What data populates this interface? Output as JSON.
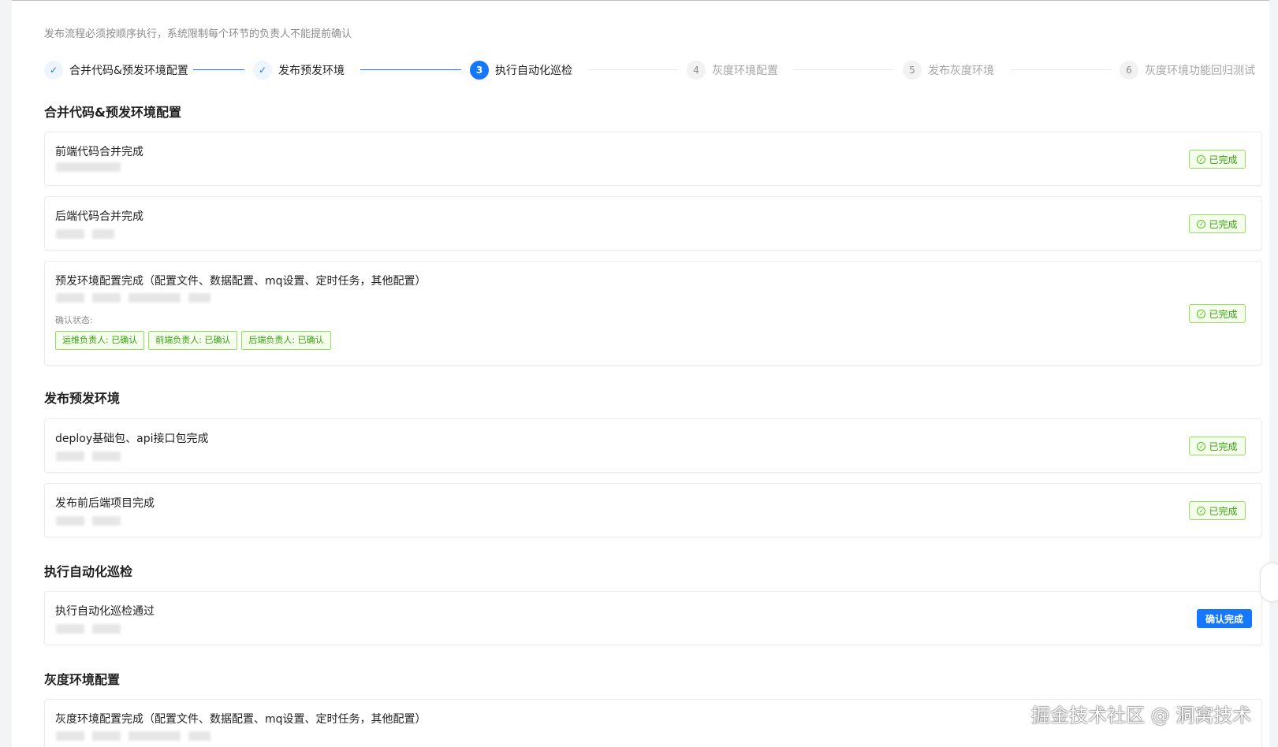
{
  "hint": "发布流程必须按顺序执行，系统限制每个环节的负责人不能提前确认",
  "steps": [
    {
      "index": "1",
      "title": "合并代码&预发环境配置",
      "status": "done",
      "icon": "check-icon"
    },
    {
      "index": "2",
      "title": "发布预发环境",
      "status": "done",
      "icon": "check-icon"
    },
    {
      "index": "3",
      "title": "执行自动化巡检",
      "status": "active"
    },
    {
      "index": "4",
      "title": "灰度环境配置",
      "status": "wait"
    },
    {
      "index": "5",
      "title": "发布灰度环境",
      "status": "wait"
    },
    {
      "index": "6",
      "title": "灰度环境功能回归测试",
      "status": "wait"
    }
  ],
  "sections": [
    {
      "title": "合并代码&预发环境配置",
      "items": [
        {
          "title": "前端代码合并完成",
          "status_label": "已完成"
        },
        {
          "title": "后端代码合并完成",
          "status_label": "已完成"
        },
        {
          "title": "预发环境配置完成（配置文件、数据配置、mq设置、定时任务，其他配置）",
          "status_label": "已完成",
          "confirm_label": "确认状态:",
          "confirm_tags": [
            "运维负责人: 已确认",
            "前端负责人: 已确认",
            "后端负责人: 已确认"
          ]
        }
      ]
    },
    {
      "title": "发布预发环境",
      "items": [
        {
          "title": "deploy基础包、api接口包完成",
          "status_label": "已完成"
        },
        {
          "title": "发布前后端项目完成",
          "status_label": "已完成"
        }
      ]
    },
    {
      "title": "执行自动化巡检",
      "items": [
        {
          "title": "执行自动化巡检通过",
          "action_label": "确认完成"
        }
      ]
    },
    {
      "title": "灰度环境配置",
      "items": [
        {
          "title": "灰度环境配置完成（配置文件、数据配置、mq设置、定时任务，其他配置）"
        }
      ]
    }
  ],
  "watermark": "掘金技术社区 @ 洞窝技术",
  "colors": {
    "primary": "#1677ff",
    "success": "#389e0d",
    "success_bg": "#f6ffed",
    "success_border": "#95de64"
  }
}
